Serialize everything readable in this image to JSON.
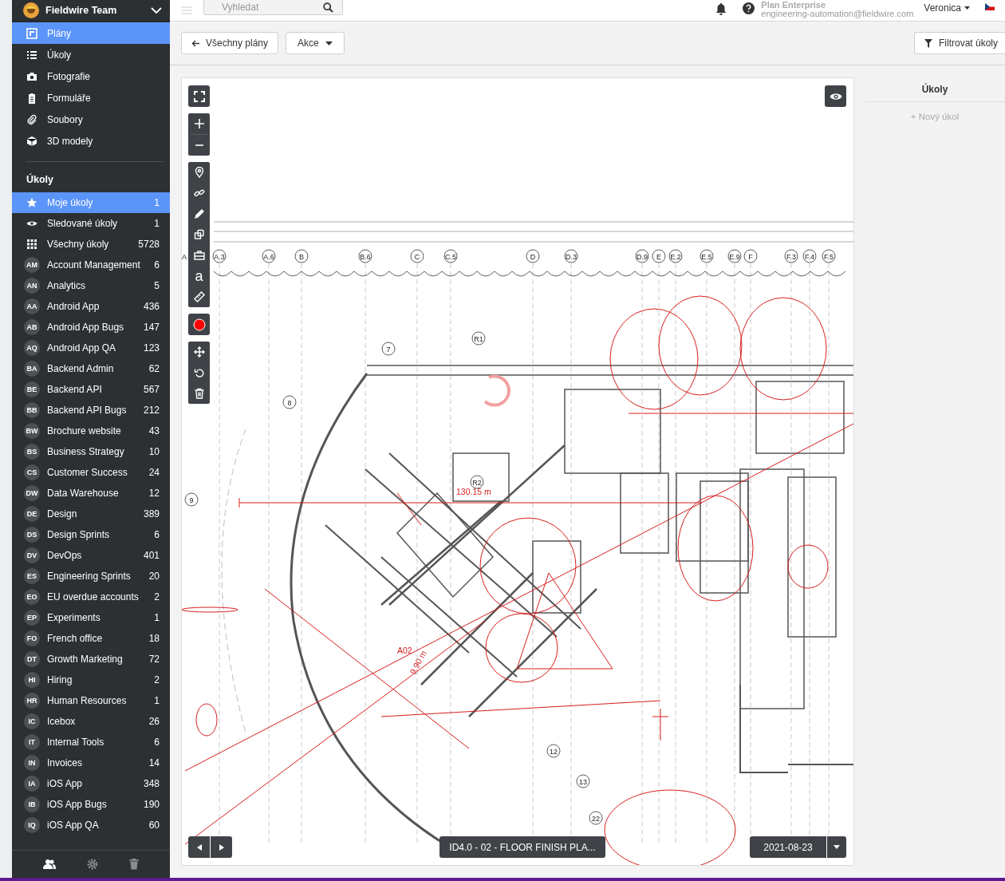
{
  "sidebar": {
    "team": "Fieldwire Team",
    "nav": [
      {
        "kind": "plans",
        "label": "Plány",
        "selected": true
      },
      {
        "kind": "list",
        "label": "Úkoly",
        "selected": false
      },
      {
        "kind": "camera",
        "label": "Fotografie",
        "selected": false
      },
      {
        "kind": "clipboard",
        "label": "Formuláře",
        "selected": false
      },
      {
        "kind": "clip",
        "label": "Soubory",
        "selected": false
      },
      {
        "kind": "cube",
        "label": "3D modely",
        "selected": false
      }
    ],
    "section_title": "Úkoly",
    "task_lists": [
      {
        "kind": "star",
        "label": "Moje úkoly",
        "count": "1",
        "selected": true
      },
      {
        "kind": "eye",
        "label": "Sledované úkoly",
        "count": "1",
        "selected": false
      },
      {
        "kind": "grid",
        "label": "Všechny úkoly",
        "count": "5728",
        "selected": false
      },
      {
        "kind": "project",
        "initials": "AM",
        "label": "Account Management",
        "count": "6",
        "selected": false
      },
      {
        "kind": "project",
        "initials": "AN",
        "label": "Analytics",
        "count": "5",
        "selected": false
      },
      {
        "kind": "project",
        "initials": "AA",
        "label": "Android App",
        "count": "436",
        "selected": false
      },
      {
        "kind": "project",
        "initials": "AB",
        "label": "Android App Bugs",
        "count": "147",
        "selected": false
      },
      {
        "kind": "project",
        "initials": "AQ",
        "label": "Android App QA",
        "count": "123",
        "selected": false
      },
      {
        "kind": "project",
        "initials": "BA",
        "label": "Backend Admin",
        "count": "62",
        "selected": false
      },
      {
        "kind": "project",
        "initials": "BE",
        "label": "Backend API",
        "count": "567",
        "selected": false
      },
      {
        "kind": "project",
        "initials": "BB",
        "label": "Backend API Bugs",
        "count": "212",
        "selected": false
      },
      {
        "kind": "project",
        "initials": "BW",
        "label": "Brochure website",
        "count": "43",
        "selected": false
      },
      {
        "kind": "project",
        "initials": "BS",
        "label": "Business Strategy",
        "count": "10",
        "selected": false
      },
      {
        "kind": "project",
        "initials": "CS",
        "label": "Customer Success",
        "count": "24",
        "selected": false
      },
      {
        "kind": "project",
        "initials": "DW",
        "label": "Data Warehouse",
        "count": "12",
        "selected": false
      },
      {
        "kind": "project",
        "initials": "DE",
        "label": "Design",
        "count": "389",
        "selected": false
      },
      {
        "kind": "project",
        "initials": "DS",
        "label": "Design Sprints",
        "count": "6",
        "selected": false
      },
      {
        "kind": "project",
        "initials": "DV",
        "label": "DevOps",
        "count": "401",
        "selected": false
      },
      {
        "kind": "project",
        "initials": "ES",
        "label": "Engineering Sprints",
        "count": "20",
        "selected": false
      },
      {
        "kind": "project",
        "initials": "EO",
        "label": "EU overdue accounts",
        "count": "2",
        "selected": false
      },
      {
        "kind": "project",
        "initials": "EP",
        "label": "Experiments",
        "count": "1",
        "selected": false
      },
      {
        "kind": "project",
        "initials": "FO",
        "label": "French office",
        "count": "18",
        "selected": false
      },
      {
        "kind": "project",
        "initials": "DT",
        "label": "Growth Marketing",
        "count": "72",
        "selected": false
      },
      {
        "kind": "project",
        "initials": "HI",
        "label": "Hiring",
        "count": "2",
        "selected": false
      },
      {
        "kind": "project",
        "initials": "HR",
        "label": "Human Resources",
        "count": "1",
        "selected": false
      },
      {
        "kind": "project",
        "initials": "IC",
        "label": "Icebox",
        "count": "26",
        "selected": false
      },
      {
        "kind": "project",
        "initials": "IT",
        "label": "Internal Tools",
        "count": "6",
        "selected": false
      },
      {
        "kind": "project",
        "initials": "IN",
        "label": "Invoices",
        "count": "14",
        "selected": false
      },
      {
        "kind": "project",
        "initials": "IA",
        "label": "iOS App",
        "count": "348",
        "selected": false
      },
      {
        "kind": "project",
        "initials": "IB",
        "label": "iOS App Bugs",
        "count": "190",
        "selected": false
      },
      {
        "kind": "project",
        "initials": "IQ",
        "label": "iOS App QA",
        "count": "60",
        "selected": false
      }
    ]
  },
  "header": {
    "search_placeholder": "Vyhledat",
    "plan_name": "Plan Enterprise",
    "email": "engineering-automation@fieldwire.com",
    "user": "Veronica"
  },
  "toolbar": {
    "back_button": "Všechny plány",
    "actions_button": "Akce",
    "filter_button": "Filtrovat úkoly"
  },
  "plan": {
    "text_tool": "a",
    "grid_labels": [
      "A",
      "A.3",
      "A.6",
      "B",
      "B.6",
      "C",
      "C.5",
      "D",
      "D.3",
      "D.9",
      "E",
      "E.2",
      "E.5",
      "E.9",
      "F",
      "F.3",
      "F.4",
      "F.5"
    ],
    "markers": [
      "7",
      "8",
      "9",
      "12",
      "13",
      "22",
      "R1",
      "R2"
    ],
    "measurements": [
      "130.15 m",
      "9.90 m",
      "A02"
    ],
    "sheet_title": "ID4.0 - 02 - FLOOR FINISH PLA...",
    "version_date": "2021-08-23"
  },
  "tasks_panel": {
    "title": "Úkoly",
    "new_task": "+ Nový úkol"
  }
}
